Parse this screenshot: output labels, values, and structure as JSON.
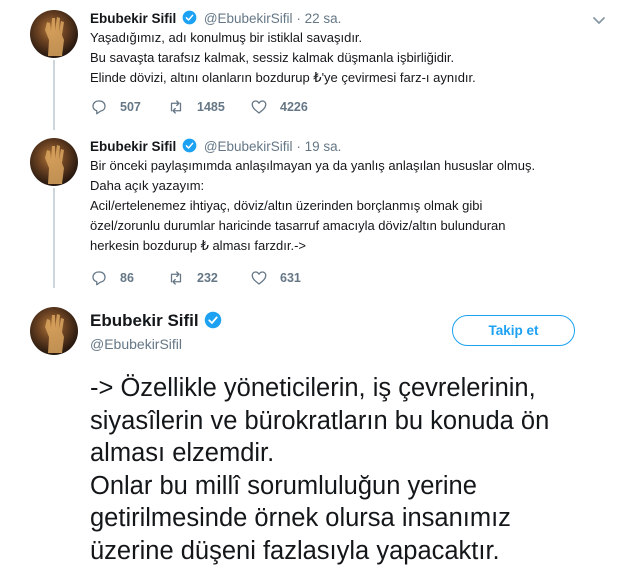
{
  "author": {
    "name": "Ebubekir Sifil",
    "handle": "@EbubekirSifil"
  },
  "tweets": [
    {
      "time": "22 sa.",
      "lines": [
        "Yaşadığımız, adı konulmuş bir istiklal savaşıdır.",
        "Bu savaşta tarafsız kalmak, sessiz kalmak düşmanla işbirliğidir.",
        "Elinde dövizi, altını olanların bozdurup ₺'ye çevirmesi farz-ı aynıdır."
      ],
      "replies": "507",
      "retweets": "1485",
      "likes": "4226"
    },
    {
      "time": "19 sa.",
      "lines": [
        "Bir önceki paylaşımımda anlaşılmayan ya da yanlış anlaşılan hususlar olmuş.",
        "Daha açık yazayım:",
        "Acil/ertelenemez ihtiyaç, döviz/altın üzerinden borçlanmış olmak gibi",
        "özel/zorunlu durumlar haricinde tasarruf amacıyla döviz/altın bulunduran",
        "herkesin bozdurup ₺ alması farzdır.->"
      ],
      "replies": "86",
      "retweets": "232",
      "likes": "631"
    }
  ],
  "main_tweet": {
    "follow_label": "Takip et",
    "lines": [
      "-> Özellikle yöneticilerin, iş çevrelerinin,",
      "siyasîlerin ve bürokratların bu konuda ön",
      "alması elzemdir.",
      "Onlar bu millî sorumluluğun yerine",
      "getirilmesinde örnek olursa insanımız",
      "üzerine düşeni fazlasıyla yapacaktır."
    ]
  },
  "colors": {
    "accent": "#1da1f2",
    "muted": "#657786",
    "text": "#14171a",
    "thread_line": "#ccd6dd"
  }
}
